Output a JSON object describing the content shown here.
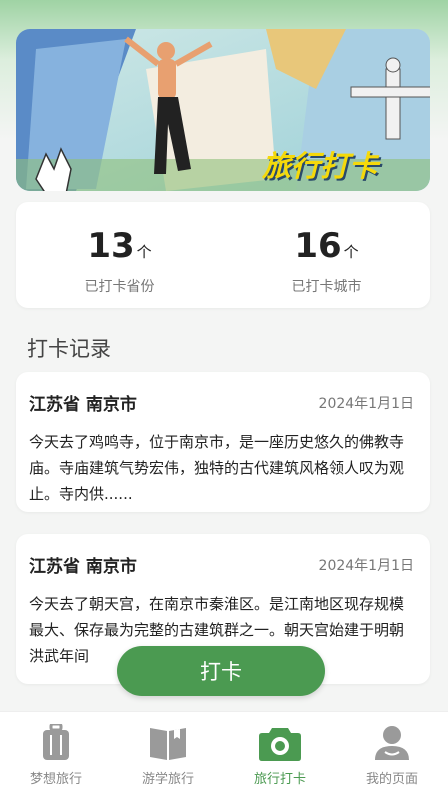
{
  "banner": {
    "title": "旅行打卡"
  },
  "stats": [
    {
      "value": "13",
      "unit": "个",
      "label": "已打卡省份"
    },
    {
      "value": "16",
      "unit": "个",
      "label": "已打卡城市"
    }
  ],
  "records_title": "打卡记录",
  "records": [
    {
      "location": "江苏省 南京市",
      "date": "2024年1月1日",
      "text": "今天去了鸡鸣寺，位于南京市，是一座历史悠久的佛教寺庙。寺庙建筑气势宏伟，独特的古代建筑风格领人叹为观止。寺内供......"
    },
    {
      "location": "江苏省 南京市",
      "date": "2024年1月1日",
      "text": "今天去了朝天宫，在南京市秦淮区。是江南地区现存规模最大、保存最为完整的古建筑群之一。朝天宫始建于明朝洪武年间"
    }
  ],
  "checkin_button": "打卡",
  "tabs": [
    {
      "label": "梦想旅行",
      "icon": "luggage-icon"
    },
    {
      "label": "游学旅行",
      "icon": "book-icon"
    },
    {
      "label": "旅行打卡",
      "icon": "camera-icon",
      "active": true
    },
    {
      "label": "我的页面",
      "icon": "user-icon"
    }
  ],
  "colors": {
    "accent": "#4b9a51",
    "banner_title": "#f5d90a"
  }
}
